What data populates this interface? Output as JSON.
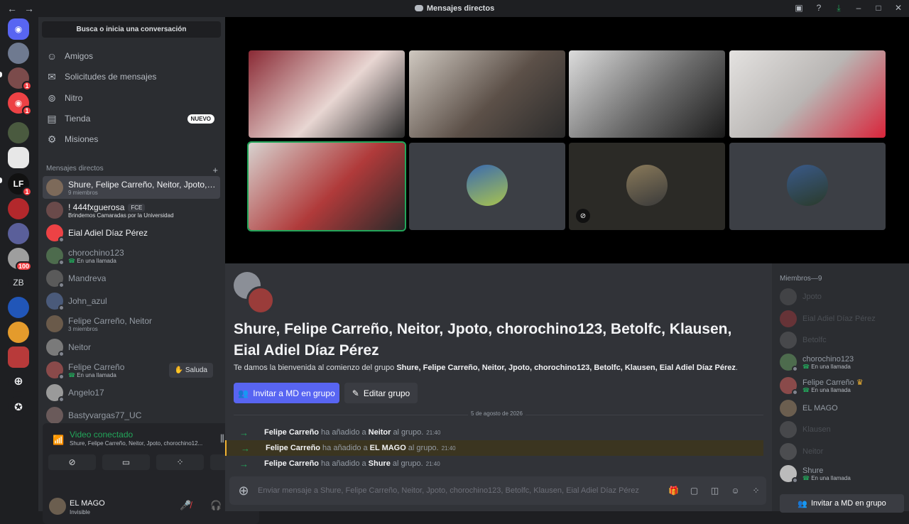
{
  "window": {
    "title": "Mensajes directos"
  },
  "sidebar": {
    "search_placeholder": "Busca o inicia una conversación",
    "nav": [
      {
        "label": "Amigos"
      },
      {
        "label": "Solicitudes de mensajes"
      },
      {
        "label": "Nitro"
      },
      {
        "label": "Tienda",
        "badge": "NUEVO"
      },
      {
        "label": "Misiones"
      }
    ],
    "dm_header": "Mensajes directos",
    "dms": [
      {
        "name": "Shure, Felipe Carreño, Neitor, Jpoto, ch...",
        "sub": "9 miembros"
      },
      {
        "name": "! 444fxguerosa",
        "tag": "FCE",
        "sub": "Brindemos Camaradas por la Universidad"
      },
      {
        "name": "Eial Adiel Díaz Pérez"
      },
      {
        "name": "chorochino123",
        "sub": "En una llamada"
      },
      {
        "name": "Mandreva"
      },
      {
        "name": "John_azul"
      },
      {
        "name": "Felipe Carreño, Neitor",
        "sub": "3 miembros"
      },
      {
        "name": "Neitor"
      },
      {
        "name": "Felipe Carreño",
        "sub": "En una llamada",
        "action": "Saluda"
      },
      {
        "name": "Angelo17"
      },
      {
        "name": "Bastyvargas77_UC"
      }
    ],
    "guild_badges": [
      "1",
      "1",
      "1",
      "100"
    ],
    "guild_label_zb": "ZB"
  },
  "voice": {
    "status": "Video conectado",
    "channel": "Shure, Felipe Carreño, Neitor, Jpoto, chorochino12..."
  },
  "user": {
    "name": "EL MAGO",
    "status": "Invisible"
  },
  "chat": {
    "group_title": "Shure, Felipe Carreño, Neitor, Jpoto, chorochino123, Betolfc, Klausen, Eial Adiel Díaz Pérez",
    "welcome_prefix": "Te damos la bienvenida al comienzo del grupo ",
    "welcome_group": "Shure, Felipe Carreño, Neitor, Jpoto, chorochino123, Betolfc, Klausen, Eial Adiel Díaz Pérez",
    "welcome_suffix": ".",
    "invite_button": "Invitar a MD en grupo",
    "edit_button": "Editar grupo",
    "date_divider": "5 de agosto de 2026",
    "messages": [
      {
        "actor": "Felipe Carreño",
        "verb": "ha añadido a",
        "target": "Neitor",
        "tail": "al grupo.",
        "time": "21:40"
      },
      {
        "actor": "Felipe Carreño",
        "verb": "ha añadido a",
        "target": "EL MAGO",
        "tail": "al grupo.",
        "time": "21:40"
      },
      {
        "actor": "Felipe Carreño",
        "verb": "ha añadido a",
        "target": "Shure",
        "tail": "al grupo.",
        "time": "21:40"
      }
    ],
    "composer_placeholder": "Enviar mensaje a Shure, Felipe Carreño, Neitor, Jpoto, chorochino123, Betolfc, Klausen, Eial Adiel Díaz Pérez"
  },
  "members": {
    "header": "Miembros—9",
    "list": [
      {
        "name": "Jpoto"
      },
      {
        "name": "Eial Adiel Díaz Pérez"
      },
      {
        "name": "Betolfc"
      },
      {
        "name": "chorochino123",
        "sub": "En una llamada"
      },
      {
        "name": "Felipe Carreño",
        "sub": "En una llamada",
        "crown": "♛"
      },
      {
        "name": "EL MAGO"
      },
      {
        "name": "Klausen"
      },
      {
        "name": "Neitor"
      },
      {
        "name": "Shure",
        "sub": "En una llamada"
      }
    ],
    "invite_button": "Invitar a MD en grupo"
  },
  "colors": {
    "accent": "#5865f2",
    "online": "#23a55a",
    "danger": "#f23f43",
    "mention": "#f0b232"
  },
  "icons": [
    "back-icon",
    "forward-icon",
    "inbox-icon",
    "help-icon",
    "download-icon",
    "minimize-icon",
    "maximize-icon",
    "close-icon"
  ]
}
